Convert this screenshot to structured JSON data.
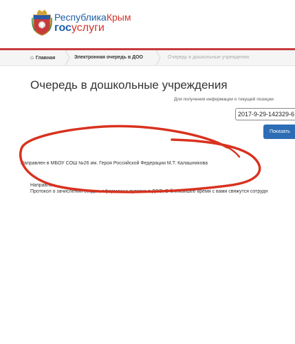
{
  "brand": {
    "name_part1": "Республика",
    "name_part2": "Крым",
    "service_part1": "гос",
    "service_part2": "услуги"
  },
  "breadcrumb": {
    "home": "Главная",
    "queue": "Электронная очередь в ДОО",
    "current": "Очередь в дошкольные учреждения"
  },
  "page": {
    "title": "Очередь в дошкольные учреждения",
    "hint": "Для получения информации о текущей позиции"
  },
  "search": {
    "value": "2017-9-29-142329-6",
    "button_label": "Показать"
  },
  "results": {
    "assigned": "Направлен в МБОУ СОШ №26 им. Героя Российской Федерации М.Т. Калашникова",
    "status_partial": "Направлен",
    "protocol": "Протокол о зачислении создан, оформлена путевка в ДОО. В ближайшее время с вами свяжутся сотрудн"
  },
  "colors": {
    "brand_blue": "#1d5ea8",
    "brand_red": "#d6322b",
    "header_line": "#c8393b",
    "button_blue": "#2d6db5",
    "annotation_red": "#d8321f"
  },
  "icons": {
    "home": "home-icon",
    "emblem": "crimea-emblem-icon"
  }
}
